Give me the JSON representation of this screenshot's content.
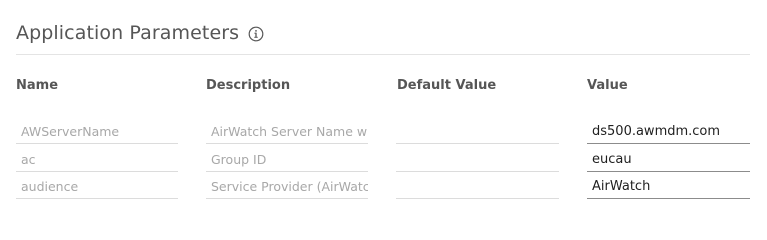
{
  "header": {
    "title": "Application Parameters",
    "info_icon": "info-circle-icon"
  },
  "table": {
    "columns": [
      "Name",
      "Description",
      "Default Value",
      "Value"
    ],
    "rows": [
      {
        "name": "AWServerName",
        "description": "AirWatch Server Name wi",
        "default_value": "",
        "value": "ds500.awmdm.com"
      },
      {
        "name": "ac",
        "description": "Group ID",
        "default_value": "",
        "value": "eucau"
      },
      {
        "name": "audience",
        "description": "Service Provider (AirWatc",
        "default_value": "",
        "value": "AirWatch"
      }
    ]
  },
  "colors": {
    "title_text": "#565656",
    "disabled_text": "#a8a8a8",
    "value_text": "#1f1f1f",
    "divider": "#e4e4e4"
  }
}
